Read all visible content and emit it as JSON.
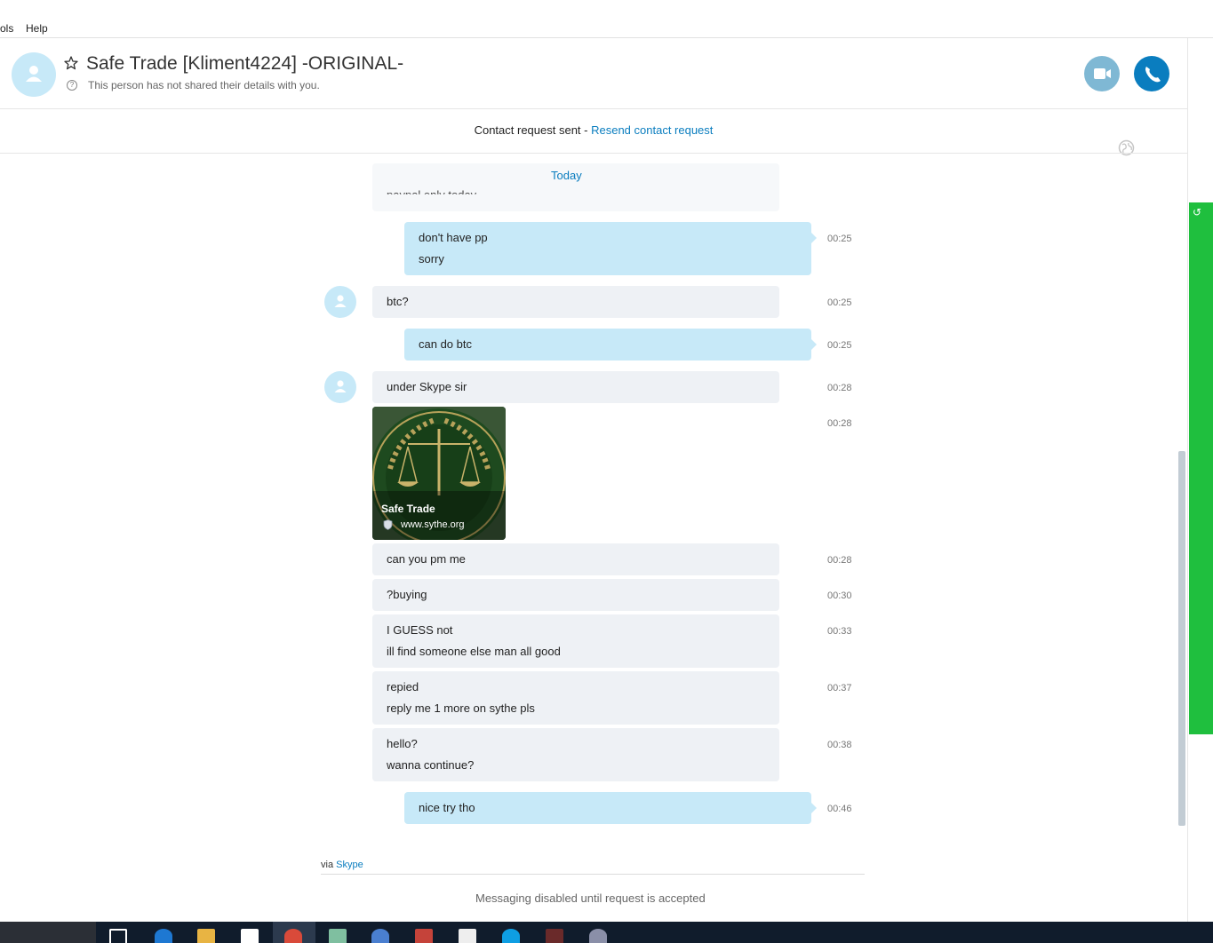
{
  "menu": {
    "tools": "ols",
    "help": "Help"
  },
  "header": {
    "contact_name": "Safe Trade [Kliment4224] -ORIGINAL-",
    "subtitle": "This person has not shared their details with you."
  },
  "request_bar": {
    "status": "Contact request sent - ",
    "link": "Resend contact request"
  },
  "chat": {
    "date_divider": "Today",
    "ghost_message": "paypal only today",
    "messages": [
      {
        "lines": [
          "don't have pp",
          "sorry"
        ],
        "time": "00:25"
      },
      {
        "lines": [
          "btc?"
        ],
        "time": "00:25"
      },
      {
        "lines": [
          "can do btc"
        ],
        "time": "00:25"
      },
      {
        "lines": [
          "under Skype sir"
        ],
        "time": "00:28"
      },
      {
        "lines": [
          "can you pm me"
        ],
        "time": "00:28"
      },
      {
        "lines": [
          "?buying"
        ],
        "time": "00:30"
      },
      {
        "lines": [
          "I GUESS not",
          "ill find someone else man all good"
        ],
        "time": "00:33"
      },
      {
        "lines": [
          "repied",
          "reply me 1 more on sythe pls"
        ],
        "time": "00:37"
      },
      {
        "lines": [
          "hello?",
          "wanna continue?"
        ],
        "time": "00:38"
      },
      {
        "lines": [
          "nice try tho"
        ],
        "time": "00:46"
      }
    ],
    "link_card": {
      "title": "Safe Trade",
      "url": "www.sythe.org",
      "time": "00:28"
    }
  },
  "footer": {
    "via": "via ",
    "via_link": "Skype",
    "disabled": "Messaging disabled until request is accepted"
  },
  "colors": {
    "accent": "#0a7dbf",
    "outgoing_bubble": "#c7e9f8",
    "incoming_bubble": "#eef1f5",
    "side_panel": "#1fbf3e"
  }
}
